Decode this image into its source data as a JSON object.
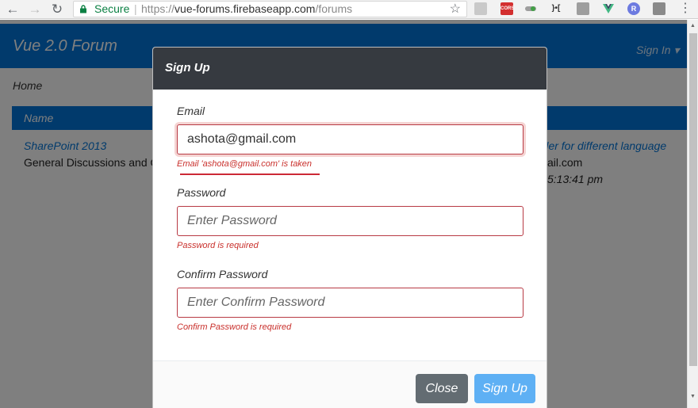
{
  "browser": {
    "secure_label": "Secure",
    "url_prefix": "https://",
    "url_host": "vue-forums.firebaseapp.com",
    "url_path": "/forums",
    "extensions": [
      {
        "name": "page-icon",
        "label": ""
      },
      {
        "name": "cors-extension-icon",
        "label": "CORS"
      },
      {
        "name": "toggle-extension-icon",
        "label": ""
      },
      {
        "name": "bracket-extension-icon",
        "label": "}•["
      },
      {
        "name": "office-extension-icon",
        "label": ""
      },
      {
        "name": "vue-devtools-icon",
        "label": ""
      },
      {
        "name": "r-extension-icon",
        "label": "R"
      },
      {
        "name": "shield-extension-icon",
        "label": ""
      }
    ]
  },
  "app": {
    "brand": "Vue 2.0 Forum",
    "signin_label": "Sign In ▾",
    "breadcrumb": "Home",
    "table_header": "Name",
    "forum_title": "SharePoint 2013",
    "forum_desc": "General Discussions and Q",
    "last_post_title": "rder for different language",
    "last_post_author": "ail.com",
    "last_post_time": "5:13:41 pm"
  },
  "modal": {
    "title": "Sign Up",
    "email_label": "Email",
    "email_value": "ashota@gmail.com",
    "email_error": "Email 'ashota@gmail.com' is taken",
    "password_label": "Password",
    "password_placeholder": "Enter Password",
    "password_error": "Password is required",
    "confirm_label": "Confirm Password",
    "confirm_placeholder": "Enter Confirm Password",
    "confirm_error": "Confirm Password is required",
    "close_label": "Close",
    "signup_label": "Sign Up"
  },
  "colors": {
    "primary": "#0275d8",
    "modal_header": "#363a40",
    "error": "#c9302c",
    "close_button": "#636c72",
    "signup_button": "#5eb0f4"
  }
}
